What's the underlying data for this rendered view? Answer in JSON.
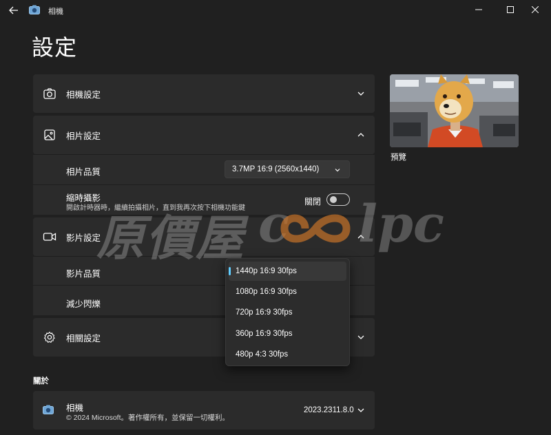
{
  "titlebar": {
    "app_title": "相機",
    "back_icon": "back-arrow-icon",
    "app_icon": "camera-icon"
  },
  "page": {
    "title": "設定"
  },
  "sections": {
    "camera": {
      "title": "相機設定",
      "icon": "camera-icon",
      "expanded": false
    },
    "photo": {
      "title": "相片設定",
      "icon": "image-icon",
      "expanded": true,
      "quality_label": "相片品質",
      "quality_value": "3.7MP 16:9 (2560x1440)",
      "timelapse_label": "縮時攝影",
      "timelapse_desc": "開啟計時器時，繼續拍攝相片，直到我再次按下相機功能鍵",
      "timelapse_state": "關閉"
    },
    "video": {
      "title": "影片設定",
      "icon": "video-icon",
      "expanded": true,
      "quality_label": "影片品質",
      "flicker_label": "減少閃爍"
    },
    "related": {
      "title": "相關設定",
      "icon": "gear-icon",
      "expanded": false
    }
  },
  "video_quality_dropdown": {
    "options": [
      "1440p 16:9 30fps",
      "1080p 16:9 30fps",
      "720p 16:9 30fps",
      "360p 16:9 30fps",
      "480p 4:3 30fps"
    ],
    "selected_index": 0
  },
  "preview": {
    "label": "預覽"
  },
  "about": {
    "section_label": "關於",
    "app_name": "相機",
    "copyright": "© 2024 Microsoft。著作權所有，並保留一切權利。",
    "version": "2023.2311.8.0"
  },
  "watermark": {
    "text_cn": "原價屋",
    "text_c": "c",
    "text_lpc": "lpc"
  },
  "colors": {
    "background": "#202020",
    "card": "#2b2b2b",
    "accent": "#60cdff",
    "watermark_orange": "#c8742a"
  }
}
